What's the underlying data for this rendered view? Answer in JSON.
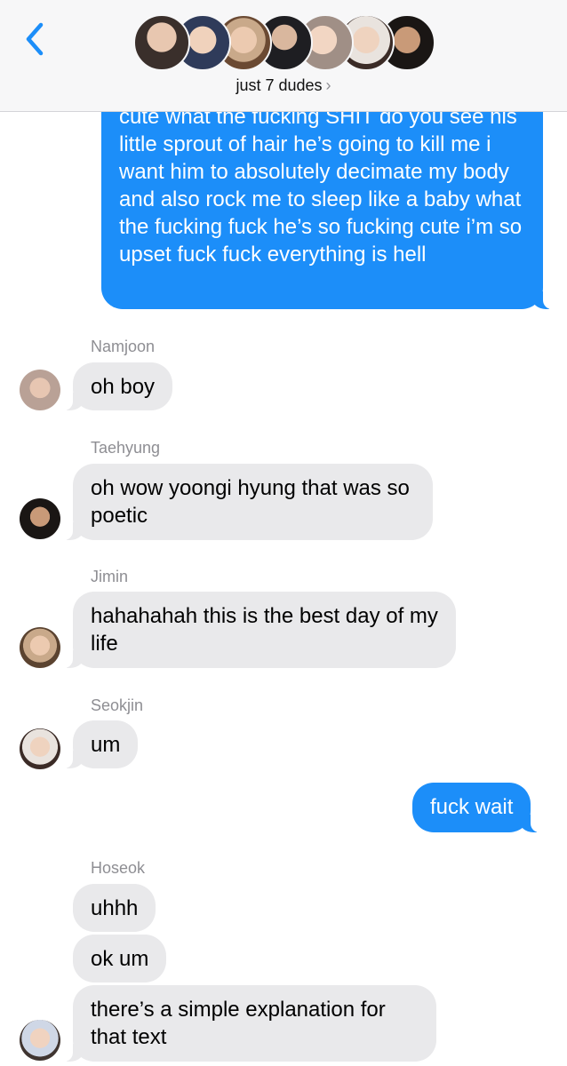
{
  "header": {
    "group_name": "just 7 dudes",
    "back_label": "back",
    "member_avatars": [
      "avatar-1",
      "avatar-2",
      "avatar-3",
      "avatar-4",
      "avatar-5",
      "avatar-6",
      "avatar-7"
    ]
  },
  "messages": {
    "m0": {
      "text": "cute what the fucking SHIT do you see his little sprout of hair he’s going to kill me i want him to absolutely decimate my body and also rock me to sleep like a baby what the fucking fuck he’s so fucking cute i’m so upset fuck fuck everything is hell"
    },
    "m1": {
      "sender": "Namjoon",
      "text": "oh boy"
    },
    "m2": {
      "sender": "Taehyung",
      "text": "oh wow yoongi hyung that was so poetic"
    },
    "m3": {
      "sender": "Jimin",
      "text": "hahahahah this is the best day of my life"
    },
    "m4": {
      "sender": "Seokjin",
      "text": "um"
    },
    "m5": {
      "text": "fuck wait"
    },
    "m6": {
      "sender": "Hoseok",
      "text": "uhhh"
    },
    "m7": {
      "text": "ok um"
    },
    "m8": {
      "text": "there’s a simple explanation for that text"
    }
  },
  "colors": {
    "accent": "#1c8ef9",
    "incoming_bubble": "#e9e9eb",
    "header_bg": "#f7f7f8",
    "secondary_text": "#8e8e93",
    "back_chevron": "#1c8ef9"
  }
}
